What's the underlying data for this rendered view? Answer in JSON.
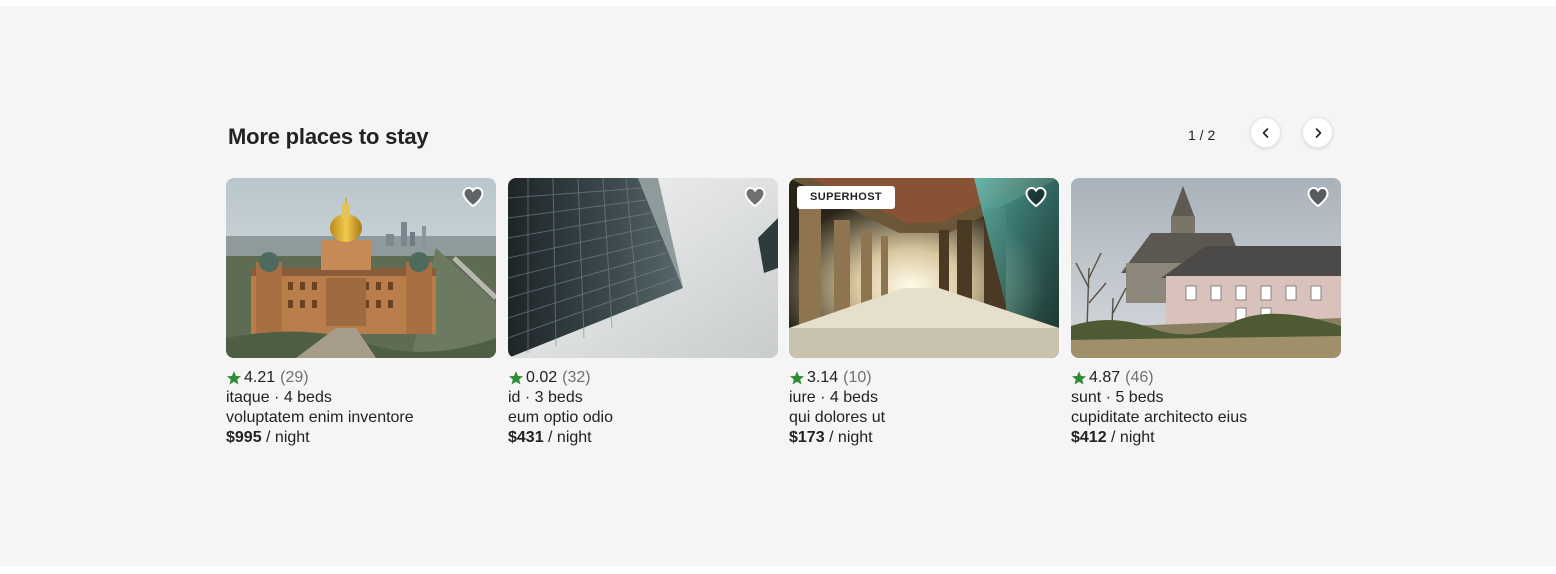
{
  "section": {
    "title": "More places to stay",
    "pager": "1 / 2",
    "prev_icon": "chevron-left-icon",
    "next_icon": "chevron-right-icon"
  },
  "colors": {
    "star": "#2e8b36",
    "background": "#f5f5f5",
    "heart_fill": "rgba(0,0,0,0.5)"
  },
  "cards": [
    {
      "image": "state capitol building with golden dome",
      "rating": "4.21",
      "reviews": "(29)",
      "type_beds": "itaque · 4 beds",
      "name": "voluptatem enim inventore",
      "price": "$995",
      "price_suffix": " / night"
    },
    {
      "image": "looking up at glass skyscraper",
      "rating": "0.02",
      "reviews": "(32)",
      "type_beds": "id · 3 beds",
      "name": "eum optio odio",
      "price": "$431",
      "price_suffix": " / night"
    },
    {
      "badge": "SUPERHOST",
      "image": "temple corridor with carved pillars",
      "rating": "3.14",
      "reviews": "(10)",
      "type_beds": "iure · 4 beds",
      "name": "qui dolores ut",
      "price": "$173",
      "price_suffix": " / night"
    },
    {
      "image": "church and stone house",
      "rating": "4.87",
      "reviews": "(46)",
      "type_beds": "sunt · 5 beds",
      "name": "cupiditate architecto eius",
      "price": "$412",
      "price_suffix": " / night"
    }
  ]
}
